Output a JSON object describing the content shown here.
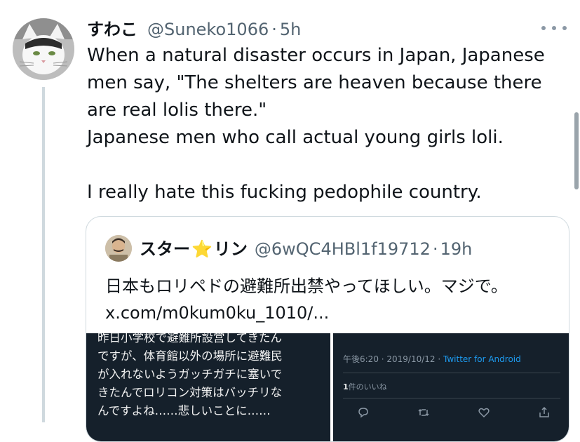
{
  "tweet": {
    "author_name": "すわこ",
    "author_handle": "@Suneko1066",
    "separator": "·",
    "time": "5h",
    "body_lines": [
      "When a natural disaster occurs in Japan, Japanese",
      "men say, \"The shelters are heaven because there",
      "are real lolis there.\"",
      "Japanese men who call actual young girls loli.",
      "",
      "I really hate this fucking pedophile country."
    ]
  },
  "quote": {
    "author_name_a": "スター",
    "author_name_star": "⭐",
    "author_name_b": "リン",
    "author_handle": "@6wQC4HBl1f19712",
    "separator": "·",
    "time": "19h",
    "text_line1": "日本もロリペドの避難所出禁やってほしい。マジで。",
    "text_line2": "x.com/m0kum0ku_1010/...",
    "media_left_lines": [
      "昨日小学校で避難所設営してきたん",
      "ですが、体育館以外の場所に避難民",
      "が入れないようガッチガチに塞いで",
      "きたんでロリコン対策はバッチリな",
      "んですよね……悲しいことに……"
    ],
    "media_right": {
      "timestamp": "午後6:20 · 2019/10/12 · ",
      "client": "Twitter for Android",
      "likes_count": "1",
      "likes_label": "件のいいね"
    }
  },
  "icons": {
    "more": "more-horizontal-icon",
    "reply": "reply-icon",
    "retweet": "retweet-icon",
    "like": "heart-icon",
    "share": "share-icon"
  },
  "colors": {
    "text": "#0f1419",
    "secondary": "#536471",
    "border": "#cfd9de",
    "link": "#1d9bf0",
    "dark_media_bg": "#15202b"
  }
}
